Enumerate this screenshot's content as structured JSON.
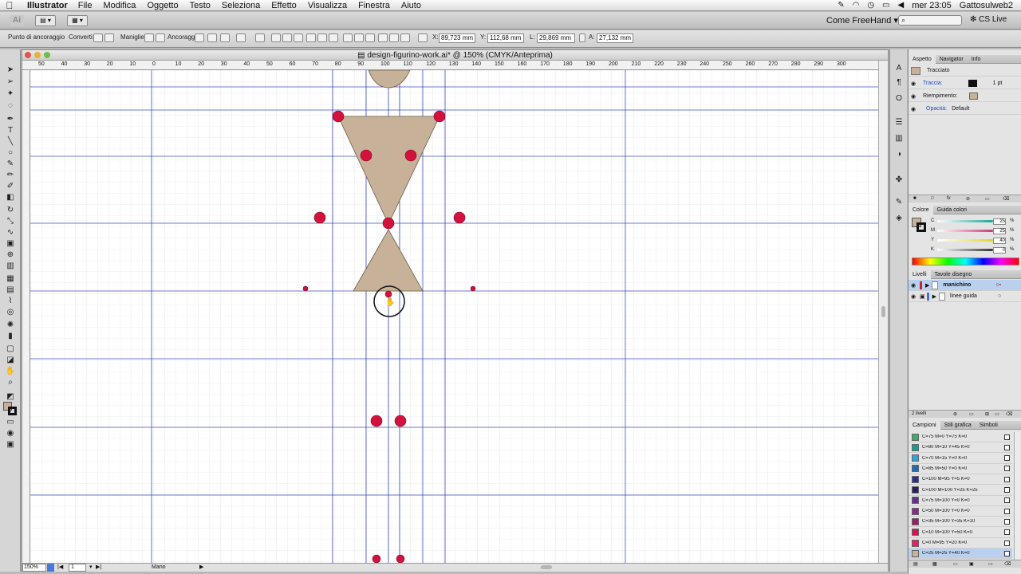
{
  "menubar": {
    "app_name": "Illustrator",
    "menus": [
      "File",
      "Modifica",
      "Oggetto",
      "Testo",
      "Seleziona",
      "Effetto",
      "Visualizza",
      "Finestra",
      "Aiuto"
    ],
    "clock": "mer 23:05",
    "user": "Gattosulweb2"
  },
  "appbar": {
    "logo": "Ai",
    "workspace": "Come FreeHand",
    "cs_live": "CS Live"
  },
  "controlbar": {
    "anchor_label": "Punto di ancoraggio",
    "convert_label": "Converti:",
    "handles_label": "Maniglie:",
    "anchors_label": "Ancoraggi:",
    "x_label": "X:",
    "x_value": "89,723 mm",
    "y_label": "Y:",
    "y_value": "112,68 mm",
    "w_label": "L:",
    "w_value": "29,869 mm",
    "h_label": "A:",
    "h_value": "27,132 mm"
  },
  "document": {
    "title": "design-figurino-work.ai* @ 150% (CMYK/Anteprima)",
    "ruler_labels": [
      "50",
      "40",
      "30",
      "20",
      "10",
      "0",
      "10",
      "20",
      "30",
      "40",
      "50",
      "60",
      "70",
      "80",
      "90",
      "100",
      "110",
      "120",
      "130",
      "140",
      "150",
      "160",
      "170",
      "180",
      "190",
      "200",
      "210",
      "220",
      "230",
      "240",
      "250",
      "260",
      "270",
      "280",
      "290",
      "300"
    ],
    "zoom": "150%",
    "page": "1",
    "status_mode": "Mano"
  },
  "aspetto": {
    "tabs": [
      "Aspetto",
      "Navigator",
      "Info"
    ],
    "object": "Tracciato",
    "stroke_label": "Traccia:",
    "stroke_weight": "1 pt",
    "fill_label": "Riempimento:",
    "opacity_label": "Opacità:",
    "opacity_value": "Default"
  },
  "colore": {
    "tabs": [
      "Colore",
      "Guida colori"
    ],
    "channels": [
      {
        "label": "C",
        "value": "25",
        "color": "#1aa59a"
      },
      {
        "label": "M",
        "value": "25",
        "color": "#d4347a"
      },
      {
        "label": "Y",
        "value": "40",
        "color": "#e0d530"
      },
      {
        "label": "K",
        "value": "0",
        "color": "#333333"
      }
    ],
    "percent": "%"
  },
  "livelli": {
    "tabs": [
      "Livelli",
      "Tavole disegno"
    ],
    "layers": [
      {
        "name": "manichino",
        "color": "#c8262f",
        "selected": true
      },
      {
        "name": "linee guida",
        "color": "#4a6ad8",
        "selected": false
      }
    ],
    "count": "2 livelli"
  },
  "campioni": {
    "tabs": [
      "Campioni",
      "Stili grafica",
      "Simboli"
    ],
    "swatches": [
      {
        "name": "C=75 M=0 Y=75 K=0",
        "color": "#3aac6b"
      },
      {
        "name": "C=80 M=10 Y=45 K=0",
        "color": "#13a092"
      },
      {
        "name": "C=70 M=15 Y=0 K=0",
        "color": "#2fa2dc"
      },
      {
        "name": "C=85 M=50 Y=0 K=0",
        "color": "#1f6db6"
      },
      {
        "name": "C=100 M=95 Y=5 K=0",
        "color": "#2a3090"
      },
      {
        "name": "C=100 M=100 Y=25 K=25",
        "color": "#25205e"
      },
      {
        "name": "C=75 M=100 Y=0 K=0",
        "color": "#662d91"
      },
      {
        "name": "C=50 M=100 Y=0 K=0",
        "color": "#92278f"
      },
      {
        "name": "C=35 M=100 Y=35 K=10",
        "color": "#9e1f63"
      },
      {
        "name": "C=10 M=100 Y=50 K=0",
        "color": "#d7145a"
      },
      {
        "name": "C=0 M=95 Y=20 K=0",
        "color": "#ec1c6b"
      },
      {
        "name": "C=25 M=25 Y=40 K=0",
        "color": "#c7b299"
      }
    ]
  },
  "colors": {
    "shape_fill": "#c7b299",
    "anchor": "#d2123c",
    "guide": "#3b4fc4"
  }
}
